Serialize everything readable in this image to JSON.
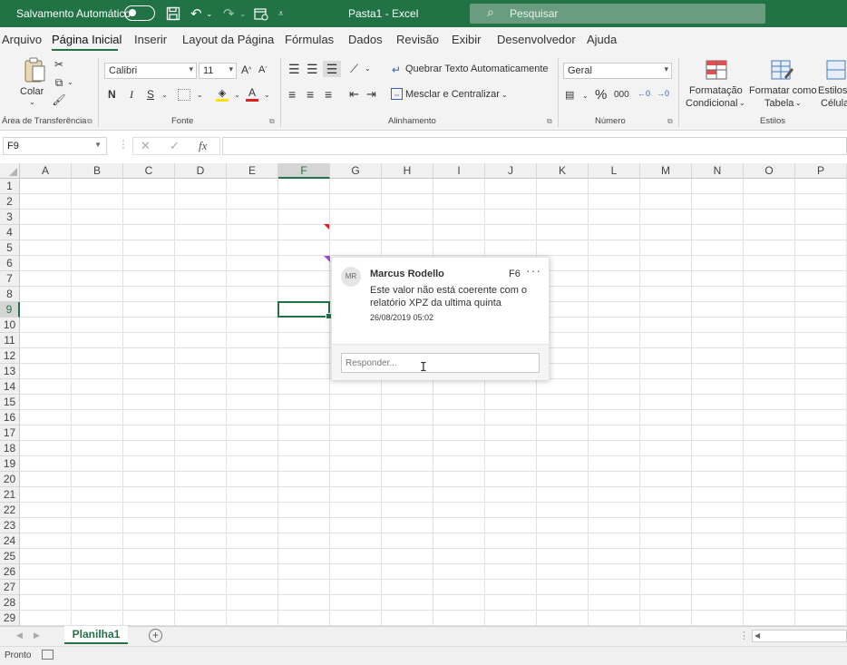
{
  "titlebar": {
    "autosave_label": "Salvamento Automático",
    "doc_title": "Pasta1  -  Excel",
    "search_placeholder": "Pesquisar"
  },
  "menu": {
    "tabs": [
      {
        "label": "Arquivo"
      },
      {
        "label": "Página Inicial",
        "active": true
      },
      {
        "label": "Inserir"
      },
      {
        "label": "Layout da Página"
      },
      {
        "label": "Fórmulas"
      },
      {
        "label": "Dados"
      },
      {
        "label": "Revisão"
      },
      {
        "label": "Exibir"
      },
      {
        "label": "Desenvolvedor"
      },
      {
        "label": "Ajuda"
      }
    ]
  },
  "ribbon": {
    "clipboard": {
      "paste_label": "Colar",
      "group_label": "Área de Transferência"
    },
    "font": {
      "font_name": "Calibri",
      "font_size": "11",
      "bold": "N",
      "italic": "I",
      "underline": "S",
      "group_label": "Fonte"
    },
    "alignment": {
      "wrap_text": "Quebrar Texto Automaticamente",
      "merge_center": "Mesclar e Centralizar",
      "group_label": "Alinhamento"
    },
    "number": {
      "format": "Geral",
      "percent": "%",
      "thousands": "000",
      "group_label": "Número"
    },
    "styles": {
      "conditional_line1": "Formatação",
      "conditional_line2": "Condicional",
      "table_line1": "Formatar como",
      "table_line2": "Tabela",
      "cell_line1": "Estilos",
      "cell_line2": "Célula",
      "group_label": "Estilos"
    }
  },
  "formula_bar": {
    "name_box": "F9",
    "fx": "fx",
    "cancel": "✕",
    "enter": "✓",
    "formula": ""
  },
  "grid": {
    "columns": [
      "A",
      "B",
      "C",
      "D",
      "E",
      "F",
      "G",
      "H",
      "I",
      "J",
      "K",
      "L",
      "M",
      "N",
      "O",
      "P"
    ],
    "rows": [
      "1",
      "2",
      "3",
      "4",
      "5",
      "6",
      "7",
      "8",
      "9",
      "10",
      "11",
      "12",
      "13",
      "14",
      "15",
      "16",
      "17",
      "18",
      "19",
      "20",
      "21",
      "22",
      "23",
      "24",
      "25",
      "26",
      "27",
      "28",
      "29"
    ],
    "selected_column": "F",
    "selected_row": "9"
  },
  "comment": {
    "avatar_initials": "MR",
    "author": "Marcus Rodello",
    "cell_ref": "F6",
    "more": "···",
    "text": "Este valor não está coerente com o relatório XPZ da ultima quinta",
    "date": "26/08/2019 05:02",
    "reply_placeholder": "Responder..."
  },
  "sheets": {
    "tabs": [
      {
        "label": "Planilha1"
      }
    ],
    "add_label": "+"
  },
  "status": {
    "text": "Pronto"
  },
  "colors": {
    "brand": "#217346",
    "comment_marker": "#e02020",
    "thread_marker": "#9b4fd8"
  }
}
